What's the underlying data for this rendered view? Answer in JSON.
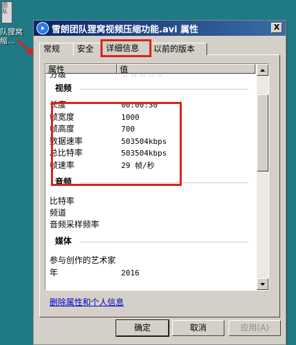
{
  "desktop": {
    "icon_text": "团队",
    "label_lines": [
      "队狸窝",
      "缩..."
    ]
  },
  "dialog": {
    "title": "雪朗团队狸窝视频压缩功能.avi 属性",
    "close_glyph": "X",
    "tabs": [
      "常规",
      "安全",
      "详细信息",
      "以前的版本"
    ],
    "active_tab": "详细信息",
    "columns": {
      "name": "属性",
      "value": "值"
    },
    "rows": [
      {
        "type": "field",
        "name": "分级",
        "value": "☆☆☆☆☆"
      },
      {
        "type": "section",
        "name": "视频"
      },
      {
        "type": "field",
        "name": "长度",
        "value": "00:00:30"
      },
      {
        "type": "field",
        "name": "帧宽度",
        "value": "1000"
      },
      {
        "type": "field",
        "name": "帧高度",
        "value": "700"
      },
      {
        "type": "field",
        "name": "数据速率",
        "value": "503504kbps"
      },
      {
        "type": "field",
        "name": "总比特率",
        "value": "503504kbps"
      },
      {
        "type": "field",
        "name": "帧速率",
        "value": "29 帧/秒"
      },
      {
        "type": "section",
        "name": "音频"
      },
      {
        "type": "field",
        "name": "比特率",
        "value": ""
      },
      {
        "type": "field",
        "name": "频道",
        "value": ""
      },
      {
        "type": "field",
        "name": "音频采样频率",
        "value": ""
      },
      {
        "type": "section",
        "name": "媒体"
      },
      {
        "type": "field",
        "name": "参与创作的艺术家",
        "value": ""
      },
      {
        "type": "field",
        "name": "年",
        "value": "2016"
      }
    ],
    "remove_link": "删除属性和个人信息",
    "buttons": {
      "ok": "确定",
      "cancel": "取消",
      "apply": "应用(A)"
    },
    "colors": {
      "highlight": "#e0201c",
      "titlebar": "#0a246a",
      "face": "#d4d0c8"
    }
  }
}
